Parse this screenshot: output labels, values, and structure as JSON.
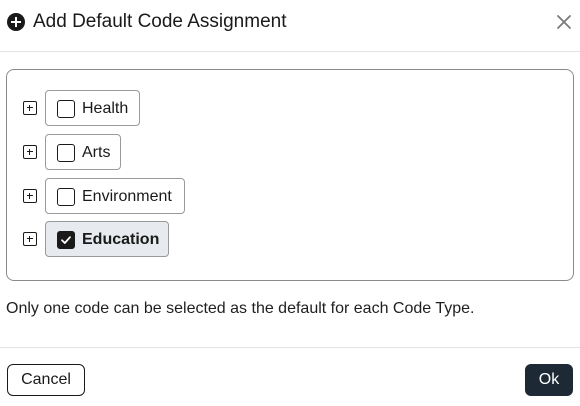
{
  "dialog": {
    "title": "Add Default Code Assignment",
    "title_icon": "plus-circle-icon",
    "close_icon": "close-icon"
  },
  "tree": {
    "items": [
      {
        "label": "Health",
        "checked": false,
        "expand_icon": "plus-square-icon"
      },
      {
        "label": "Arts",
        "checked": false,
        "expand_icon": "plus-square-icon"
      },
      {
        "label": "Environment",
        "checked": false,
        "expand_icon": "plus-square-icon"
      },
      {
        "label": "Education",
        "checked": true,
        "expand_icon": "plus-square-icon"
      }
    ]
  },
  "helper_text": "Only one code can be selected as the default for each Code Type.",
  "footer": {
    "cancel_label": "Cancel",
    "ok_label": "Ok"
  },
  "colors": {
    "primary_button": "#1d2a36",
    "selected_chip_bg": "#e7eaee"
  }
}
